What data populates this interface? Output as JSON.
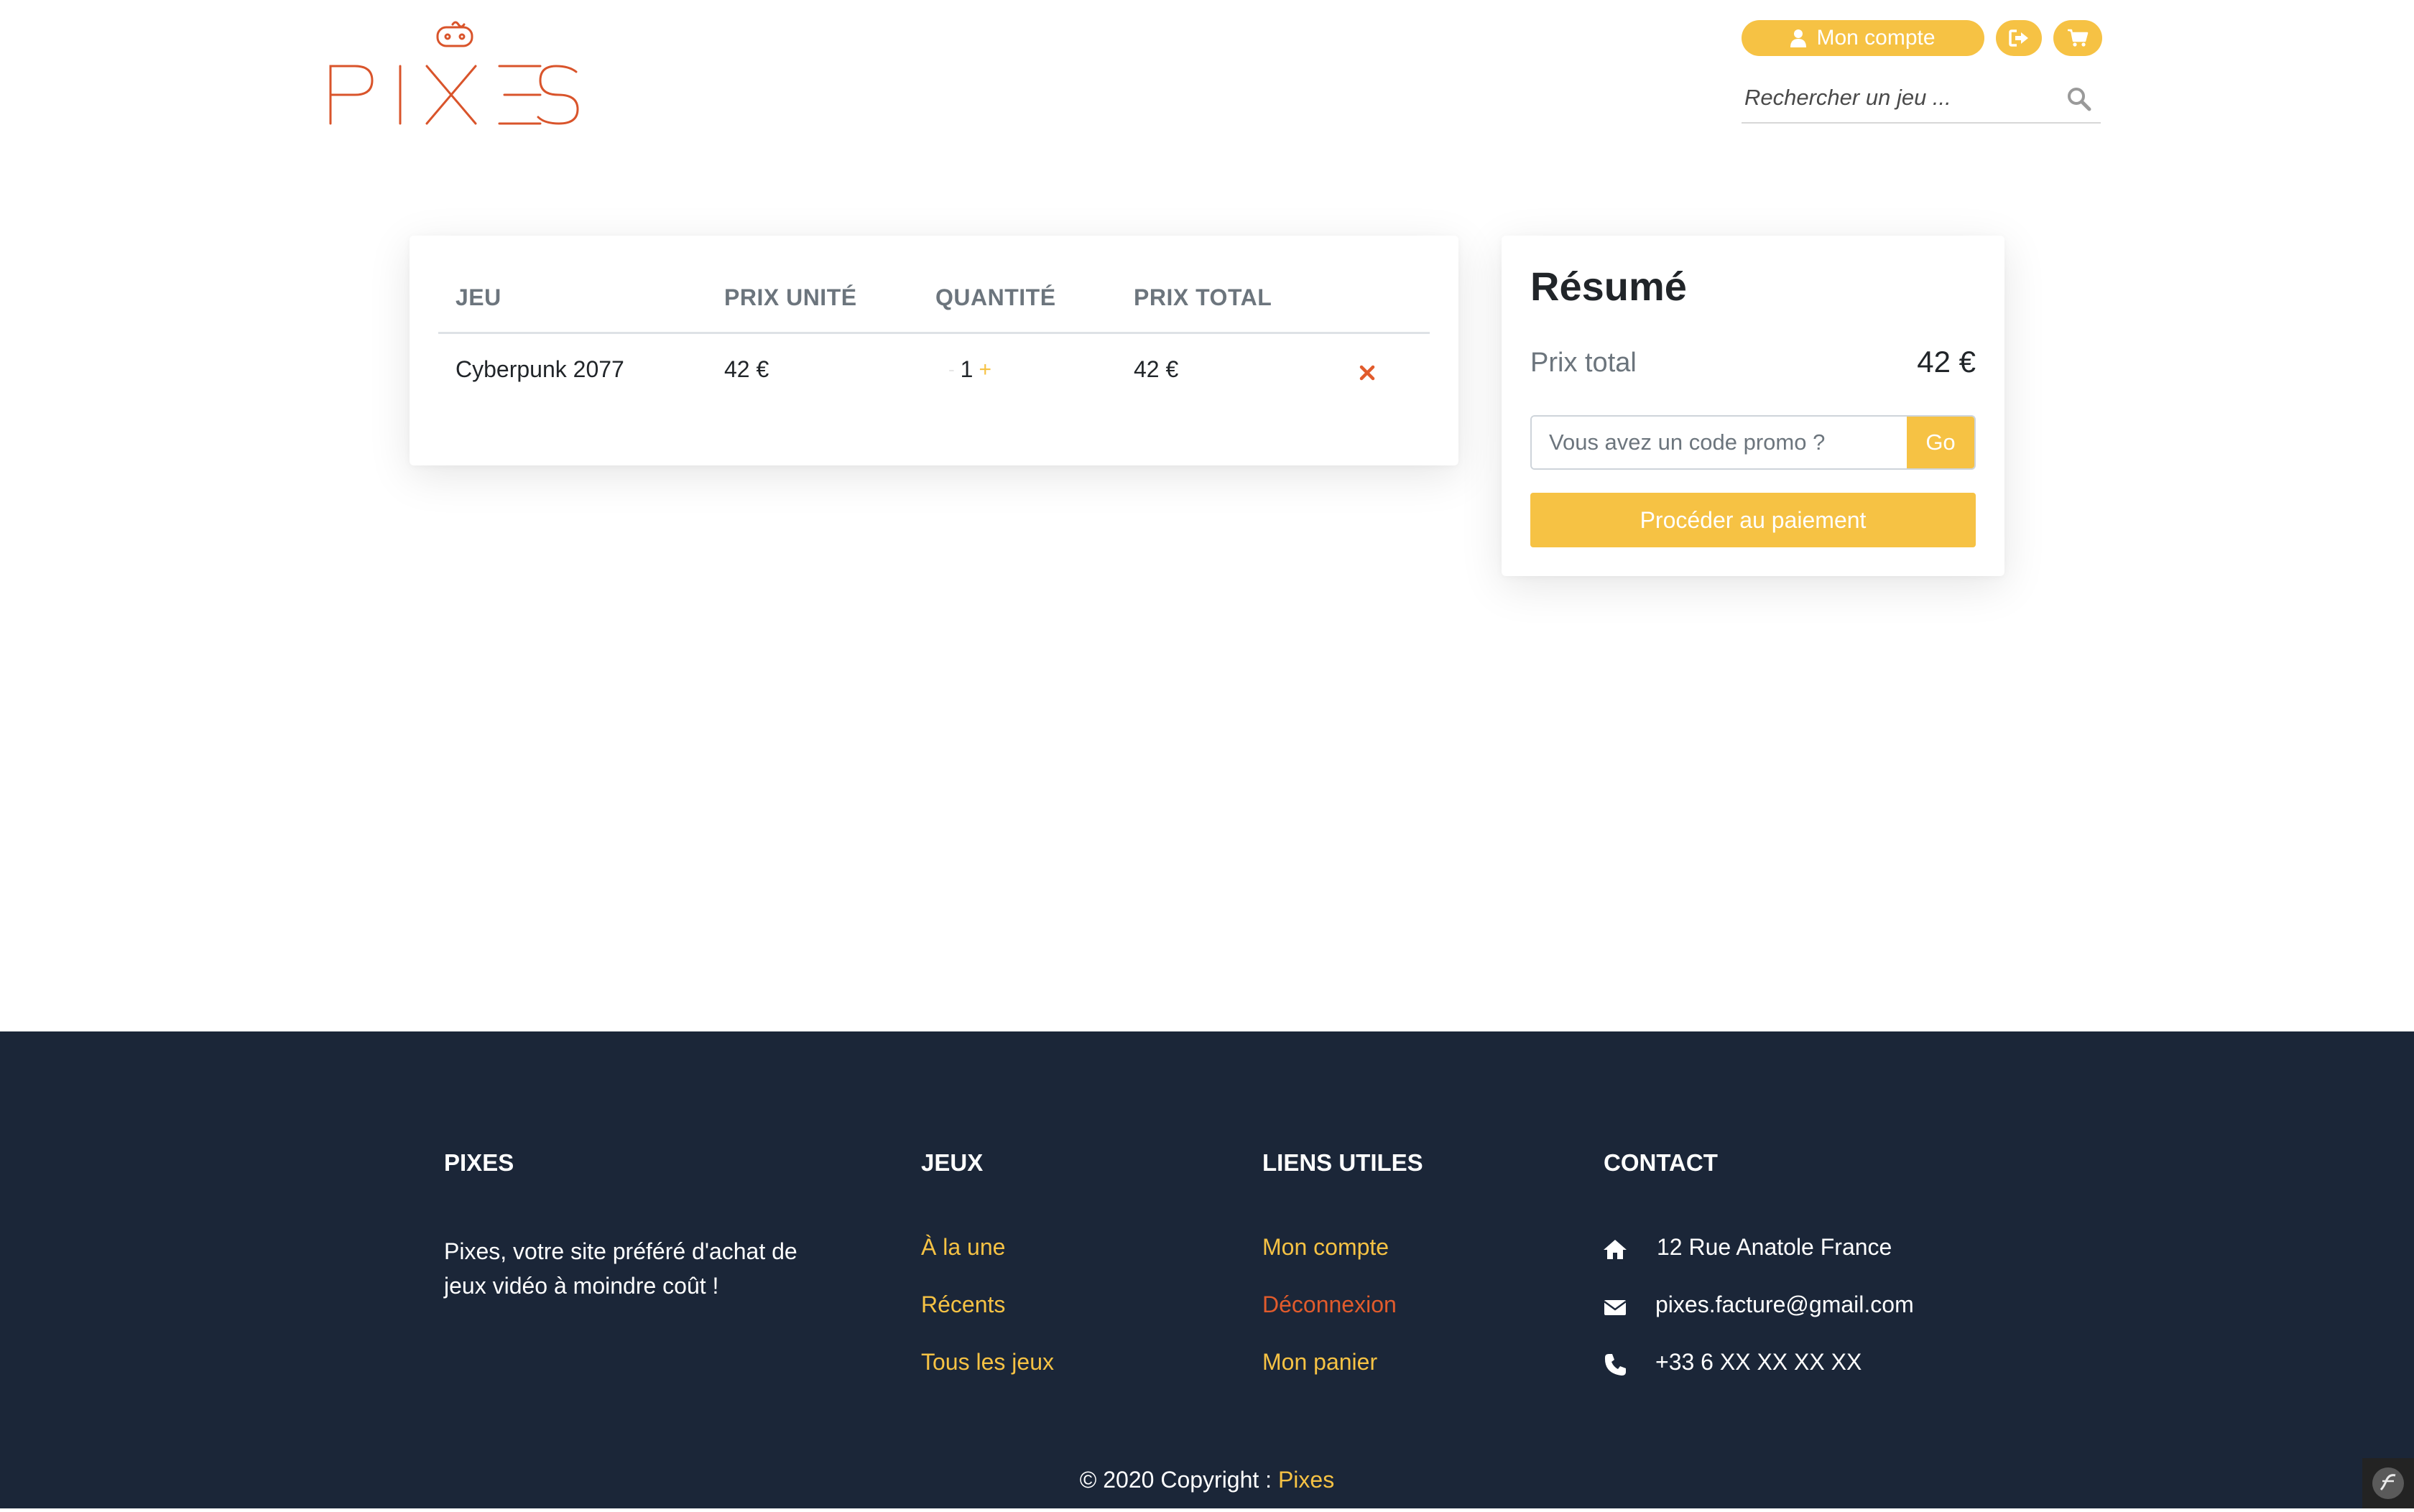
{
  "brand": {
    "logo_text": "PIXES",
    "accent_color": "#f6c244",
    "logo_color": "#d9542b"
  },
  "header": {
    "account_label": "Mon compte",
    "account_icon": "user-icon",
    "logout_icon": "sign-out-icon",
    "cart_icon": "cart-icon",
    "search_placeholder": "Rechercher un jeu ...",
    "search_icon": "search-icon"
  },
  "cart": {
    "columns": [
      "JEU",
      "PRIX UNITÉ",
      "QUANTITÉ",
      "PRIX TOTAL"
    ],
    "rows": [
      {
        "name": "Cyberpunk 2077",
        "unit_price": "42 €",
        "quantity": "1",
        "total": "42 €"
      }
    ],
    "minus_symbol": "-",
    "plus_symbol": "+",
    "remove_icon": "times-icon"
  },
  "summary": {
    "title": "Résumé",
    "total_label": "Prix total",
    "total_value": "42 €",
    "promo_placeholder": "Vous avez un code promo ?",
    "promo_button": "Go",
    "pay_button": "Procéder au paiement"
  },
  "footer": {
    "background": "#1b2638",
    "col1": {
      "title": "PIXES",
      "text": "Pixes, votre site préféré d'achat de jeux vidéo à moindre coût !"
    },
    "col2": {
      "title": "JEUX",
      "links": [
        "À la une",
        "Récents",
        "Tous les jeux"
      ]
    },
    "col3": {
      "title": "LIENS UTILES",
      "links": [
        "Mon compte",
        "Déconnexion",
        "Mon panier"
      ]
    },
    "col4": {
      "title": "CONTACT",
      "items": [
        {
          "icon": "home-icon",
          "text": "12 Rue Anatole France"
        },
        {
          "icon": "envelope-icon",
          "text": "pixes.facture@gmail.com"
        },
        {
          "icon": "phone-icon",
          "text": "+33 6 XX XX XX XX"
        }
      ]
    },
    "copyright_prefix": "© 2020 Copyright : ",
    "copyright_brand": "Pixes"
  }
}
